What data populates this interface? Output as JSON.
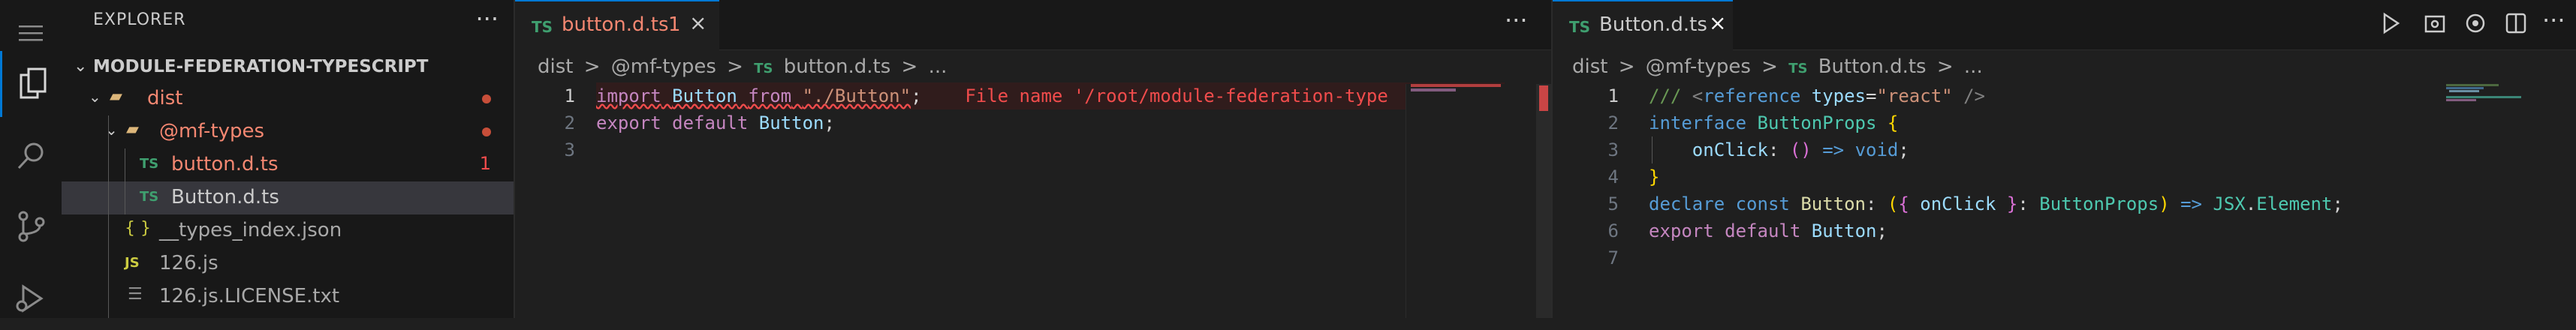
{
  "sidebar": {
    "title": "EXPLORER",
    "more": "···",
    "root": "MODULE-FEDERATION-TYPESCRIPT",
    "items": [
      {
        "label": "dist",
        "color": "#f48771"
      },
      {
        "label": "@mf-types",
        "color": "#f48771"
      },
      {
        "label": "button.d.ts",
        "badge": "1",
        "color": "#f48771"
      },
      {
        "label": "Button.d.ts",
        "color": "#cccccc"
      },
      {
        "label": "__types_index.json",
        "icon": "{ }"
      },
      {
        "label": "126.js",
        "icon": "JS"
      },
      {
        "label": "126.js.LICENSE.txt"
      }
    ]
  },
  "left_editor": {
    "tab": {
      "icon": "TS",
      "label": "button.d.ts",
      "badge": "1"
    },
    "more": "···",
    "breadcrumb": [
      "dist",
      ">",
      "@mf-types",
      ">",
      "TS",
      "button.d.ts",
      ">",
      "..."
    ],
    "line_numbers": [
      "1",
      "2",
      "3"
    ],
    "error_message": "File name '/root/module-federation-type"
  },
  "right_editor": {
    "tab": {
      "icon": "TS",
      "label": "Button.d.ts"
    },
    "breadcrumb": [
      "dist",
      ">",
      "@mf-types",
      ">",
      "TS",
      "Button.d.ts",
      ">",
      "..."
    ],
    "line_numbers": [
      "1",
      "2",
      "3",
      "4",
      "5",
      "6",
      "7"
    ]
  },
  "colors": {
    "accent": "#0078d4",
    "error": "#f14c4c",
    "ts_icon": "#3f9f6f",
    "git_modified": "#f48771"
  }
}
